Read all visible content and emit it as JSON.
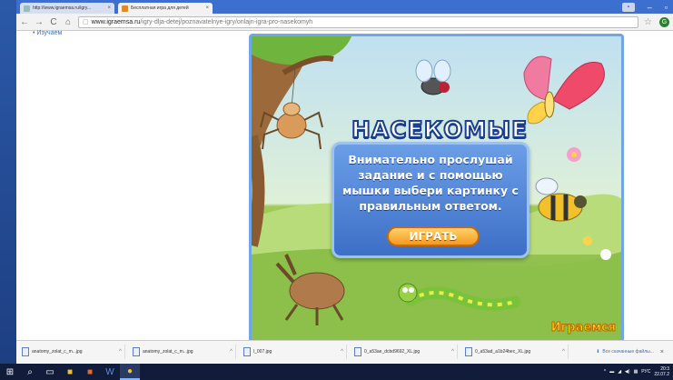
{
  "browser": {
    "tabs": [
      {
        "title": "http://www.igraemsa.ru/igry..."
      },
      {
        "title": "Бесплатная игра для детей"
      }
    ],
    "url_prefix": "www.igraemsa.ru",
    "url_path": "/igry-dlja-detej/poznavatelnye-igry/onlajn-igra-pro-nasekomyh",
    "nav": {
      "back": "←",
      "forward": "→",
      "reload": "C",
      "home": "⌂"
    }
  },
  "page": {
    "side_link": "• Изучаем"
  },
  "game": {
    "title": "НАСЕКОМЫЕ",
    "instruction_lines": [
      "Внимательно прослушай",
      "задание и с помощью",
      "мышки выбери картинку с",
      "правильным ответом."
    ],
    "play_label": "ИГРАТЬ",
    "brand": "Играемся"
  },
  "downloads": {
    "items": [
      {
        "name": "anatomy_zolat_c_m...jpg"
      },
      {
        "name": "anatomy_zolat_c_m...jpg"
      },
      {
        "name": "l_007.jpg"
      },
      {
        "name": "0_a53ae_dcbd9692_XL.jpg"
      },
      {
        "name": "0_a53ad_a1b24bec_XL.jpg"
      }
    ],
    "show_all": "Все скачанные файлы..."
  },
  "taskbar": {
    "lang": "РУС",
    "time": "20:3",
    "date": "22.07.2"
  }
}
